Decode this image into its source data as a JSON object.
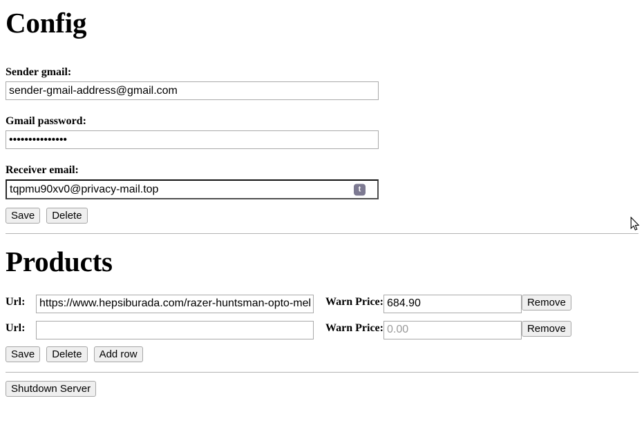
{
  "config": {
    "heading": "Config",
    "sender_label": "Sender gmail:",
    "sender_value": "sender-gmail-address@gmail.com",
    "password_label": "Gmail password:",
    "password_value": "privatepassword",
    "receiver_label": "Receiver email:",
    "receiver_value": "tqpmu90xv0@privacy-mail.top",
    "autofill_badge_text": "t",
    "save_label": "Save",
    "delete_label": "Delete"
  },
  "products": {
    "heading": "Products",
    "url_label": "Url:",
    "price_label": "Warn Price:",
    "remove_label": "Remove",
    "rows": [
      {
        "url_value": "https://www.hepsiburada.com/razer-huntsman-opto-mekanik-oyuncu-klavyesi",
        "url_placeholder": "",
        "price_value": "684.90",
        "price_placeholder": "0.00"
      },
      {
        "url_value": "",
        "url_placeholder": "",
        "price_value": "",
        "price_placeholder": "0.00"
      }
    ],
    "save_label": "Save",
    "delete_label": "Delete",
    "add_row_label": "Add row"
  },
  "footer": {
    "shutdown_label": "Shutdown Server"
  },
  "colors": {
    "badge_bg": "#7d7a92",
    "button_bg": "#efefef",
    "border": "#a9a9a9",
    "divider": "#b3b3b3",
    "placeholder": "#9a9a9a"
  }
}
